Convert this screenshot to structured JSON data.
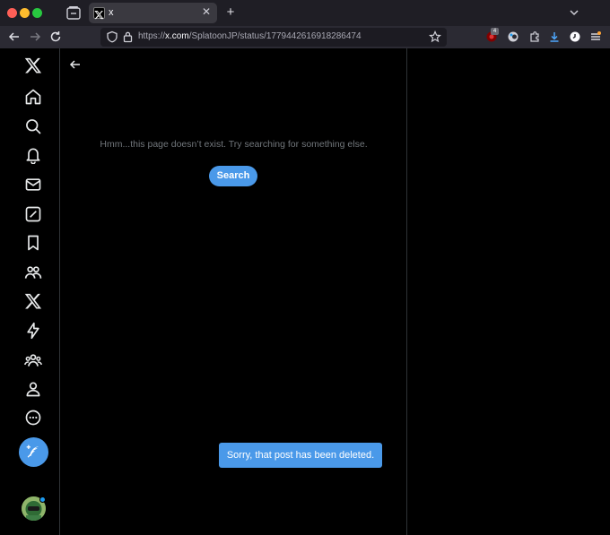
{
  "browser": {
    "tab": {
      "title": "x",
      "close_glyph": "✕"
    },
    "new_tab_glyph": "+",
    "url": {
      "scheme": "https://",
      "host": "x.com",
      "path": "/SplatoonJP/status/1779442616918286474"
    },
    "extension_badge": "4"
  },
  "icons": {
    "back": "arrow-left-icon",
    "forward": "arrow-right-icon",
    "reload": "reload-icon",
    "shield": "shield-icon",
    "lock": "lock-icon",
    "star": "star-icon"
  },
  "colors": {
    "accent": "#4a99e9",
    "background": "#000000",
    "muted_text": "#71767b",
    "divider": "#2f3336"
  },
  "sidebar": {
    "items": [
      {
        "name": "x-logo"
      },
      {
        "name": "home"
      },
      {
        "name": "explore"
      },
      {
        "name": "notifications"
      },
      {
        "name": "messages"
      },
      {
        "name": "grok"
      },
      {
        "name": "bookmarks"
      },
      {
        "name": "communities"
      },
      {
        "name": "premium"
      },
      {
        "name": "verified-orgs"
      },
      {
        "name": "lists"
      },
      {
        "name": "profile"
      },
      {
        "name": "more"
      }
    ]
  },
  "main": {
    "empty_message": "Hmm...this page doesn’t exist. Try searching for something else.",
    "search_label": "Search"
  },
  "toast": {
    "message": "Sorry, that post has been deleted."
  }
}
